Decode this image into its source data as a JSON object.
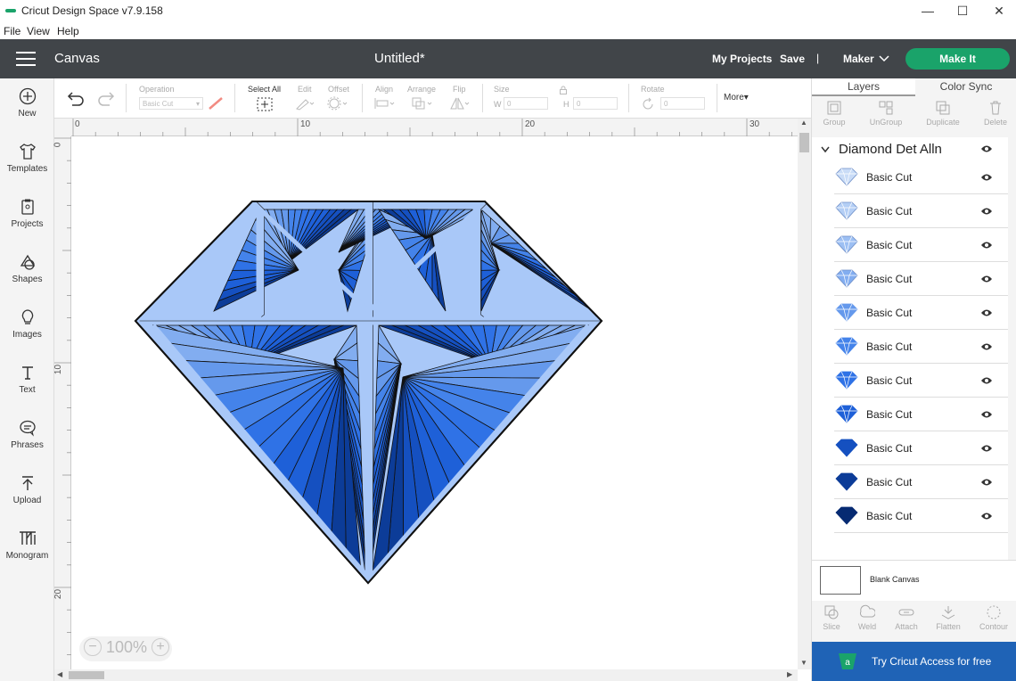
{
  "window": {
    "title": "Cricut Design Space  v7.9.158",
    "minimize": "—",
    "maximize": "☐",
    "close": "✕"
  },
  "menu": [
    "File",
    "View",
    "Help"
  ],
  "header": {
    "canvas_label": "Canvas",
    "doc_title": "Untitled*",
    "my_projects": "My Projects",
    "save": "Save",
    "separator": "|",
    "machine": "Maker",
    "make_it": "Make It"
  },
  "sidebar": [
    {
      "label": "New",
      "icon": "plus-circle-icon"
    },
    {
      "label": "Templates",
      "icon": "tshirt-icon"
    },
    {
      "label": "Projects",
      "icon": "clipboard-icon"
    },
    {
      "label": "Shapes",
      "icon": "shapes-icon"
    },
    {
      "label": "Images",
      "icon": "lightbulb-icon"
    },
    {
      "label": "Text",
      "icon": "text-icon"
    },
    {
      "label": "Phrases",
      "icon": "speech-bubble-icon"
    },
    {
      "label": "Upload",
      "icon": "upload-icon"
    },
    {
      "label": "Monogram",
      "icon": "monogram-icon"
    }
  ],
  "toolbar": {
    "operation_label": "Operation",
    "operation_value": "Basic Cut",
    "select_all": "Select All",
    "edit": "Edit",
    "offset": "Offset",
    "align": "Align",
    "arrange": "Arrange",
    "flip": "Flip",
    "size": "Size",
    "w_label": "W",
    "w_value": "0",
    "h_label": "H",
    "h_value": "0",
    "rotate": "Rotate",
    "rotate_value": "0",
    "more": "More▾"
  },
  "rulers": {
    "h_ticks": [
      "0",
      "10",
      "20",
      "30"
    ],
    "v_ticks": [
      "0",
      "10",
      "20"
    ]
  },
  "zoom": {
    "value": "100%",
    "minus": "−",
    "plus": "+"
  },
  "right_panel": {
    "tabs": [
      "Layers",
      "Color Sync"
    ],
    "tools": [
      "Group",
      "UnGroup",
      "Duplicate",
      "Delete"
    ],
    "group_name": "Diamond Det Alln",
    "layers": [
      {
        "label": "Basic Cut",
        "color": "#c9dcf7"
      },
      {
        "label": "Basic Cut",
        "color": "#b3cef5"
      },
      {
        "label": "Basic Cut",
        "color": "#9cbff3"
      },
      {
        "label": "Basic Cut",
        "color": "#82adf0"
      },
      {
        "label": "Basic Cut",
        "color": "#6599ec"
      },
      {
        "label": "Basic Cut",
        "color": "#4483ea"
      },
      {
        "label": "Basic Cut",
        "color": "#2f72e6"
      },
      {
        "label": "Basic Cut",
        "color": "#1e60d8"
      },
      {
        "label": "Basic Cut",
        "color": "#1550c0"
      },
      {
        "label": "Basic Cut",
        "color": "#0c3c98"
      },
      {
        "label": "Basic Cut",
        "color": "#062a72"
      }
    ],
    "blank_canvas": "Blank Canvas",
    "bottom_tools": [
      "Slice",
      "Weld",
      "Attach",
      "Flatten",
      "Contour"
    ],
    "access_banner": "Try Cricut Access for free"
  },
  "colors": {
    "header_bg": "#414549",
    "make_it_green": "#1aa36a",
    "access_blue": "#1f63b6",
    "diamond_light": "#9ec2f7",
    "diamond_dark": "#1a57d6"
  }
}
